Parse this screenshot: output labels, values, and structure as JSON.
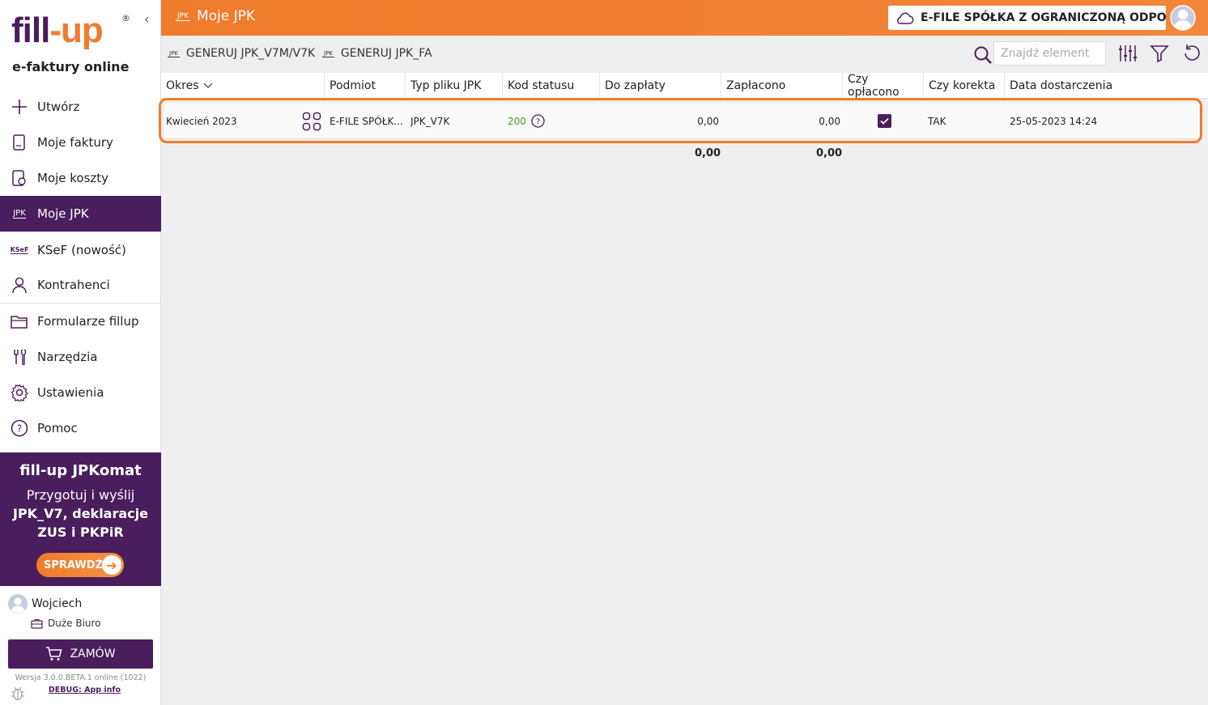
{
  "app": {
    "logo_main": "fill",
    "logo_dash": "-",
    "logo_end": "up",
    "logo_reg": "®",
    "logo_sub": "e-faktury online",
    "collapse": "‹"
  },
  "sidebar": {
    "items": [
      {
        "label": "Utwórz",
        "icon": "plus-icon"
      },
      {
        "label": "Moje faktury",
        "icon": "invoice-icon"
      },
      {
        "label": "Moje koszty",
        "icon": "costs-icon"
      },
      {
        "label": "Moje JPK",
        "icon": "jpk-icon",
        "active": true,
        "icon_text": "JPK"
      },
      {
        "label": "KSeF (nowość)",
        "icon": "ksef-icon",
        "icon_text": "KSeF"
      },
      {
        "label": "Kontrahenci",
        "icon": "person-icon"
      },
      {
        "label": "Formularze fillup",
        "icon": "folder-icon"
      },
      {
        "label": "Narzędzia",
        "icon": "tools-icon"
      },
      {
        "label": "Ustawienia",
        "icon": "gear-icon"
      },
      {
        "label": "Pomoc",
        "icon": "help-icon"
      }
    ],
    "promo": {
      "brand": "fill-up JPKomat",
      "line1": "Przygotuj i wyślij",
      "line2": "JPK_V7, deklaracje",
      "line3": "ZUS i PKPiR",
      "button": "SPRAWDŹ"
    },
    "user_name": "Wojciech",
    "office": "Duże Biuro",
    "order_button": "ZAMÓW",
    "version": "Wersja 3.0.0.BETA.1 online (1022)",
    "debug_link": "DEBUG: App info"
  },
  "header": {
    "icon_text": "JPK",
    "title": "Moje JPK",
    "company": "E-FILE SPÓŁKA Z OGRANICZONĄ ODPO..."
  },
  "toolbar": {
    "icon_text": "JPK",
    "generate_v7": "GENERUJ JPK_V7M/V7K",
    "generate_fa": "GENERUJ JPK_FA",
    "search_placeholder": "Znajdź element"
  },
  "table": {
    "columns": [
      "Okres",
      "Podmiot",
      "Typ pliku JPK",
      "Kod statusu",
      "Do zapłaty",
      "Zapłacono",
      "Czy opłacono",
      "Czy korekta",
      "Data dostarczenia"
    ],
    "rows": [
      {
        "okres": "Kwiecień 2023",
        "podmiot": "E-FILE SPÓŁK...",
        "typ": "JPK_V7K",
        "kod": "200",
        "do_zaplaty": "0,00",
        "zaplacono": "0,00",
        "czy_oplacono": true,
        "czy_korekta": "TAK",
        "data": "25-05-2023 14:24"
      }
    ],
    "totals": {
      "do_zaplaty": "0,00",
      "zaplacono": "0,00"
    }
  },
  "colors": {
    "brand_purple": "#4a1d5c",
    "brand_orange": "#f07b2c",
    "status_green": "#4a9a2c"
  }
}
